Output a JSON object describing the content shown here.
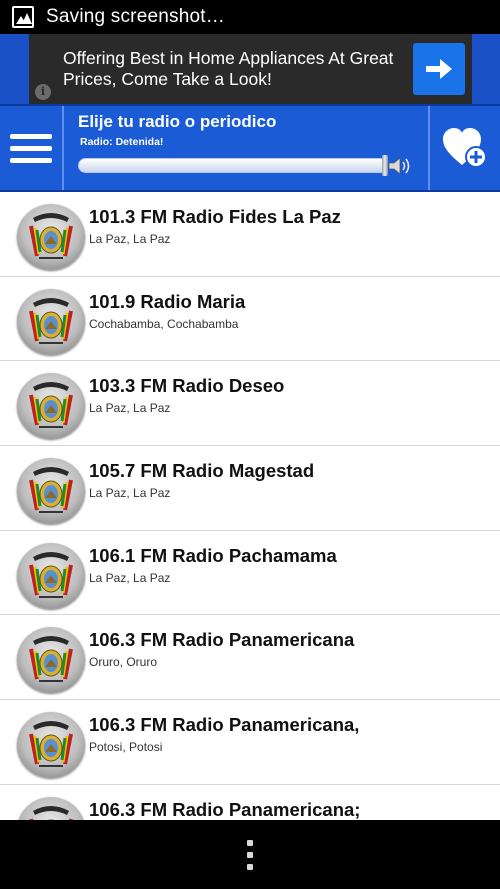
{
  "status_bar": {
    "notification_icon": "image-icon",
    "text": "Saving screenshot…"
  },
  "ad": {
    "text": "Offering Best in Home Appliances At Great Prices, Come Take a Look!",
    "info_label": "i",
    "arrow_icon": "arrow-right-icon"
  },
  "toolbar": {
    "menu_icon": "hamburger-menu-icon",
    "title": "Elije tu radio o periodico",
    "status": "Radio: Detenida!",
    "volume_icon": "speaker-icon",
    "favorite_icon": "heart-plus-icon",
    "accent_color": "#1b5bd6"
  },
  "stations": [
    {
      "name": "101.3 FM Radio Fides La Paz",
      "location": "La Paz, La Paz"
    },
    {
      "name": "101.9 Radio Maria",
      "location": "Cochabamba, Cochabamba"
    },
    {
      "name": "103.3 FM Radio Deseo",
      "location": "La Paz, La Paz"
    },
    {
      "name": "105.7 FM Radio Magestad",
      "location": "La Paz, La Paz"
    },
    {
      "name": "106.1 FM Radio Pachamama",
      "location": "La Paz, La Paz"
    },
    {
      "name": "106.3 FM Radio Panamericana",
      "location": "Oruro, Oruro"
    },
    {
      "name": "106.3 FM Radio Panamericana,",
      "location": "Potosi, Potosi"
    },
    {
      "name": "106.3 FM Radio Panamericana;",
      "location": ""
    }
  ],
  "nav": {
    "menu_icon": "overflow-menu-icon"
  }
}
